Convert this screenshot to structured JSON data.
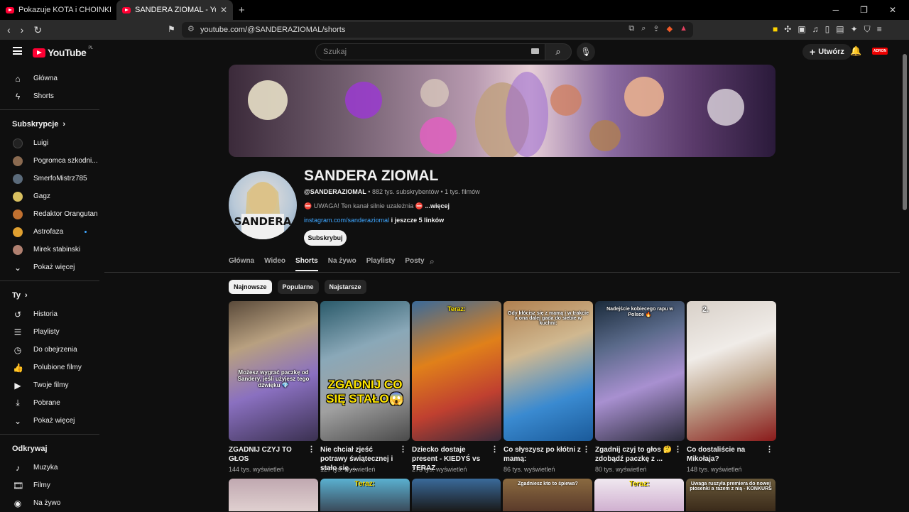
{
  "browser": {
    "tabs": [
      {
        "title": "Pokazuje KOTA i CHOINKĘ - YouTube"
      },
      {
        "title": "SANDERA ZIOMAL - YouTube"
      }
    ],
    "url": "youtube.com/@SANDERAZIOMAL/shorts"
  },
  "header": {
    "logo": "YouTube",
    "region": "PL",
    "search_placeholder": "Szukaj",
    "create_label": "Utwórz",
    "account_label": "ADRON"
  },
  "sidebar": {
    "main": [
      {
        "label": "Główna",
        "icon": "home-icon"
      },
      {
        "label": "Shorts",
        "icon": "shorts-icon"
      }
    ],
    "subs_heading": "Subskrypcje",
    "subs": [
      {
        "label": "Luigi",
        "color": "#222",
        "dot": false
      },
      {
        "label": "Pogromca szkodni...",
        "color": "#8a6a50",
        "dot": false
      },
      {
        "label": "SmerfoMistrz785",
        "color": "#5a6a7a",
        "dot": true
      },
      {
        "label": "Gagz",
        "color": "#d8c060",
        "dot": false
      },
      {
        "label": "Redaktor Orangutan",
        "color": "#c07030",
        "dot": false
      },
      {
        "label": "Astrofaza",
        "color": "#e0a030",
        "dot": true
      },
      {
        "label": "Mirek stabinski",
        "color": "#b08070",
        "dot": true
      }
    ],
    "subs_more": "Pokaż więcej",
    "you_heading": "Ty",
    "you": [
      {
        "label": "Historia",
        "icon": "history-icon"
      },
      {
        "label": "Playlisty",
        "icon": "playlist-icon"
      },
      {
        "label": "Do obejrzenia",
        "icon": "watch-later-icon"
      },
      {
        "label": "Polubione filmy",
        "icon": "like-icon"
      },
      {
        "label": "Twoje filmy",
        "icon": "your-videos-icon"
      },
      {
        "label": "Pobrane",
        "icon": "download-icon"
      }
    ],
    "you_more": "Pokaż więcej",
    "explore_heading": "Odkrywaj",
    "explore": [
      {
        "label": "Muzyka",
        "icon": "music-icon"
      },
      {
        "label": "Filmy",
        "icon": "film-icon"
      },
      {
        "label": "Na żywo",
        "icon": "live-icon"
      }
    ]
  },
  "channel": {
    "name": "SANDERA ZIOMAL",
    "handle": "@SANDERAZIOMAL",
    "subscribers": "882 tys. subskrybentów",
    "videos": "1 tys. filmów",
    "description": "⛔ UWAGA! Ten kanał silnie uzależnia ⛔",
    "more": "...więcej",
    "link": "instagram.com/sanderaziomal",
    "links_more": "i jeszcze 5 linków",
    "subscribe": "Subskrybuj",
    "avatar_text": "SANDERA"
  },
  "channel_tabs": [
    "Główna",
    "Wideo",
    "Shorts",
    "Na żywo",
    "Playlisty",
    "Posty"
  ],
  "active_tab": "Shorts",
  "chips": [
    "Najnowsze",
    "Popularne",
    "Najstarsze"
  ],
  "shorts": [
    {
      "title": "ZGADNIJ CZYJ TO GŁOS",
      "views": "144 tys. wyświetleń",
      "caption": "Możesz wygrać paczkę od Sandery, jeśli użyjesz tego dźwięku 💎",
      "bg": "linear-gradient(160deg,#5a4a3a 0%,#b8a080 30%,#8a70c0 60%,#3a3050 100%)"
    },
    {
      "title": "Nie chciał zjeść potrawy świątecznej i stało się ...",
      "views": "127 tys. wyświetleń",
      "big": "ZGADNIJ CO SIĘ STAŁO😱",
      "bg": "linear-gradient(160deg,#2a5a6a 0%,#8aa8b8 35%,#a0a0a0 65%,#4a4a4a 100%)"
    },
    {
      "title": "Dziecko dostaje present - KIEDYŚ vs TERAZ",
      "views": "273 tys. wyświetleń",
      "top": "Teraz:",
      "bg": "linear-gradient(160deg,#3a6a9a 0%,#e0801a 40%,#c04030 70%,#3a2a3a 100%)"
    },
    {
      "title": "Co słyszysz po kłótni z mamą:",
      "views": "86 tys. wyświetleń",
      "top": "Gdy kłócisz się z mamą i w trakcie a ona dalej gada do siebie w kuchni:",
      "bg": "linear-gradient(160deg,#b08050 0%,#d0b890 35%,#3a8ad0 70%,#1a5a9a 100%)"
    },
    {
      "title": "Zgadnij czyj to głos 🤔 zdobądź paczkę z ...",
      "views": "80 tys. wyświetleń",
      "top": "Nadejście kobiecego rapu w Polsce 🔥",
      "bg": "linear-gradient(160deg,#1a2a3a 0%,#5a6a8a 30%,#a890d0 60%,#2a2a3a 100%)"
    },
    {
      "title": "Co dostaliście na Mikołaja?",
      "views": "148 tys. wyświetleń",
      "top": "2.",
      "bg": "linear-gradient(160deg,#d8d0c8 0%,#f0ece8 35%,#c0a890 60%,#8a1a1a 100%)"
    }
  ],
  "shorts_row2": [
    {
      "bg": "linear-gradient(180deg,#c0a8b0,#e0d0d0)"
    },
    {
      "top": "Teraz:",
      "bg": "linear-gradient(180deg,#5ab0d0,#3a4a5a)"
    },
    {
      "bg": "linear-gradient(180deg,#3a6a9a,#1a1a1a)"
    },
    {
      "top": "Zgadniesz kto to śpiewa?",
      "bg": "linear-gradient(180deg,#8a6a40,#5a3a2a)"
    },
    {
      "top": "Teraz:",
      "bg": "linear-gradient(180deg,#f0e8f0,#d0b0d0)"
    },
    {
      "top": "Uwaga ruszyła premiera do nowej piosenki a razem z nią - KONKURS",
      "bg": "linear-gradient(180deg,#6a5a3a,#3a2a1a)"
    }
  ]
}
